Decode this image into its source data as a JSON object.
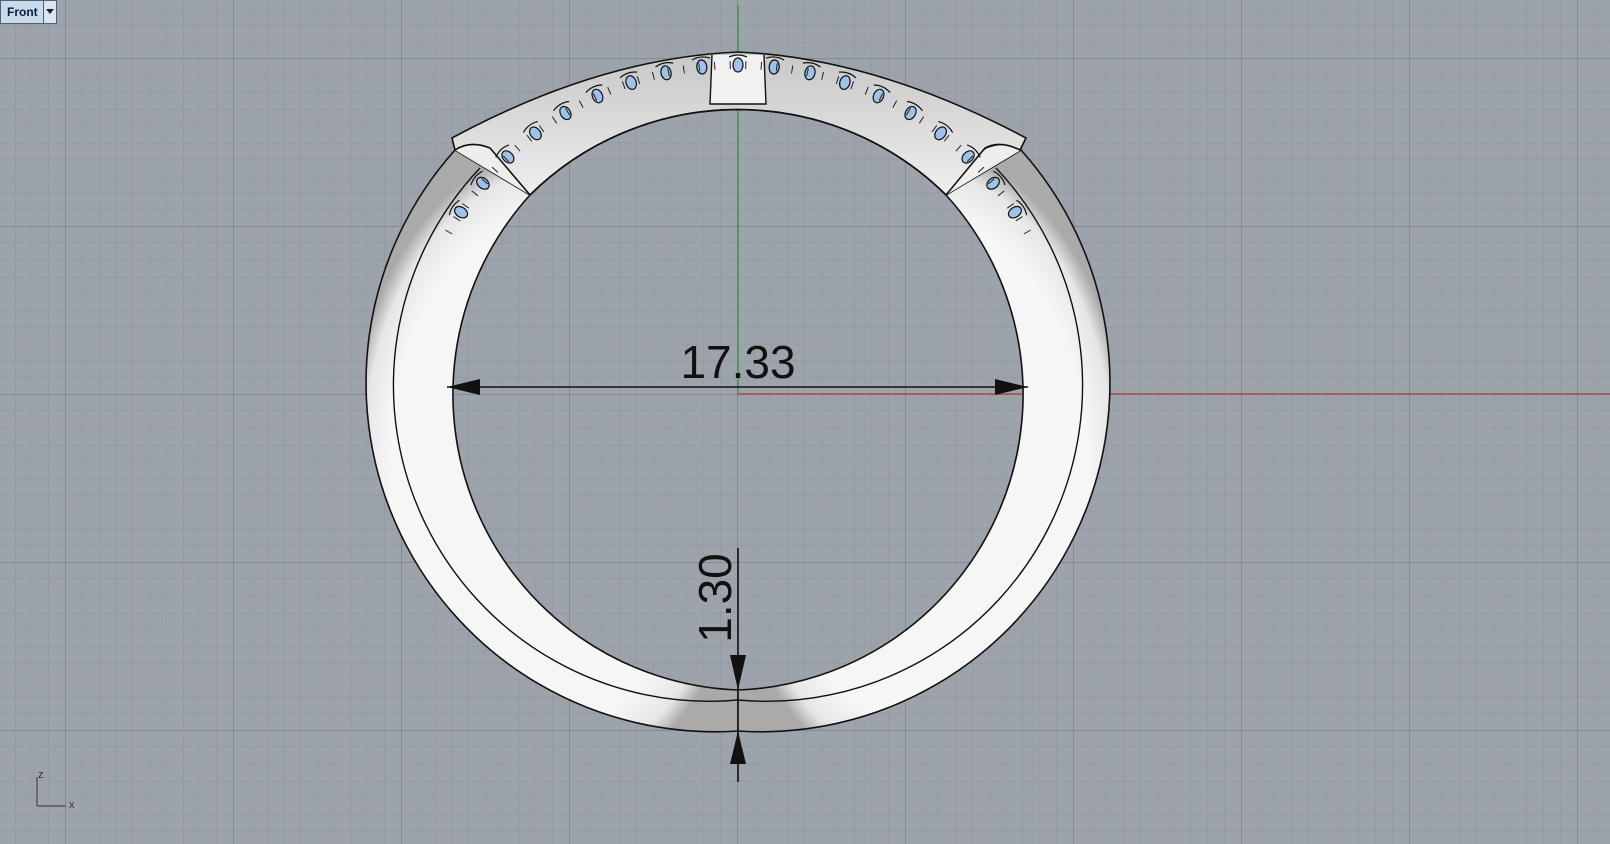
{
  "viewport": {
    "name": "Front",
    "dropdown_icon": "chevron-down-icon"
  },
  "dimensions": {
    "inner_diameter_label": "17.33",
    "band_thickness_label": "1.30"
  },
  "axes": {
    "z_label": "z",
    "x_label": "x"
  },
  "colors": {
    "background": "#9da3aa",
    "x_axis": "#b33a3a",
    "z_axis": "#3a9a3a",
    "ring_fill": "#f4f4f4",
    "ring_edge": "#111111",
    "gem_fill": "#9fc2ea"
  }
}
